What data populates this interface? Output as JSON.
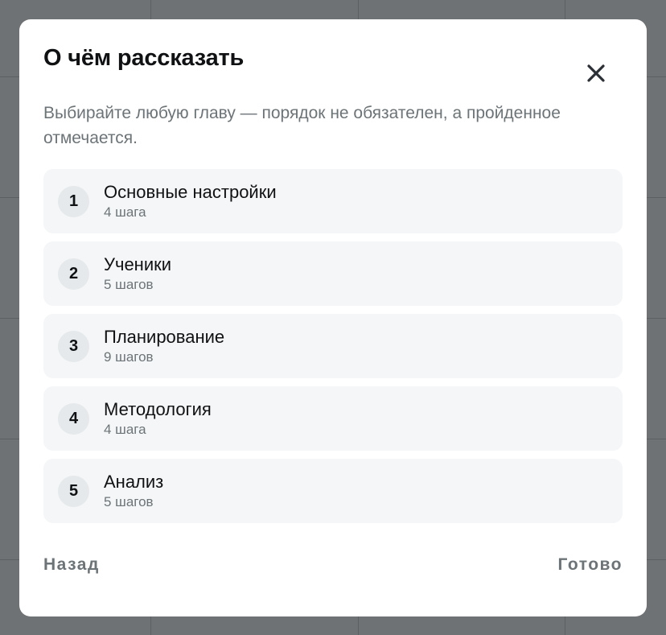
{
  "modal": {
    "title": "О чём рассказать",
    "subtitle": "Выбирайте любую главу — порядок не обязателен, а пройденное отмечается.",
    "close_icon": "close-icon",
    "chapters": [
      {
        "number": "1",
        "title": "Основные настройки",
        "steps": "4 шага"
      },
      {
        "number": "2",
        "title": "Ученики",
        "steps": "5 шагов"
      },
      {
        "number": "3",
        "title": "Планирование",
        "steps": "9 шагов"
      },
      {
        "number": "4",
        "title": "Методология",
        "steps": "4 шага"
      },
      {
        "number": "5",
        "title": "Анализ",
        "steps": "5 шагов"
      }
    ],
    "back_label": "Назад",
    "done_label": "Готово"
  },
  "colors": {
    "overlay": "#6f7274",
    "modal_bg": "#ffffff",
    "item_bg": "#f5f6f7",
    "badge_bg": "#e5e9eb",
    "text_primary": "#0f1113",
    "text_muted": "#6c7478"
  }
}
